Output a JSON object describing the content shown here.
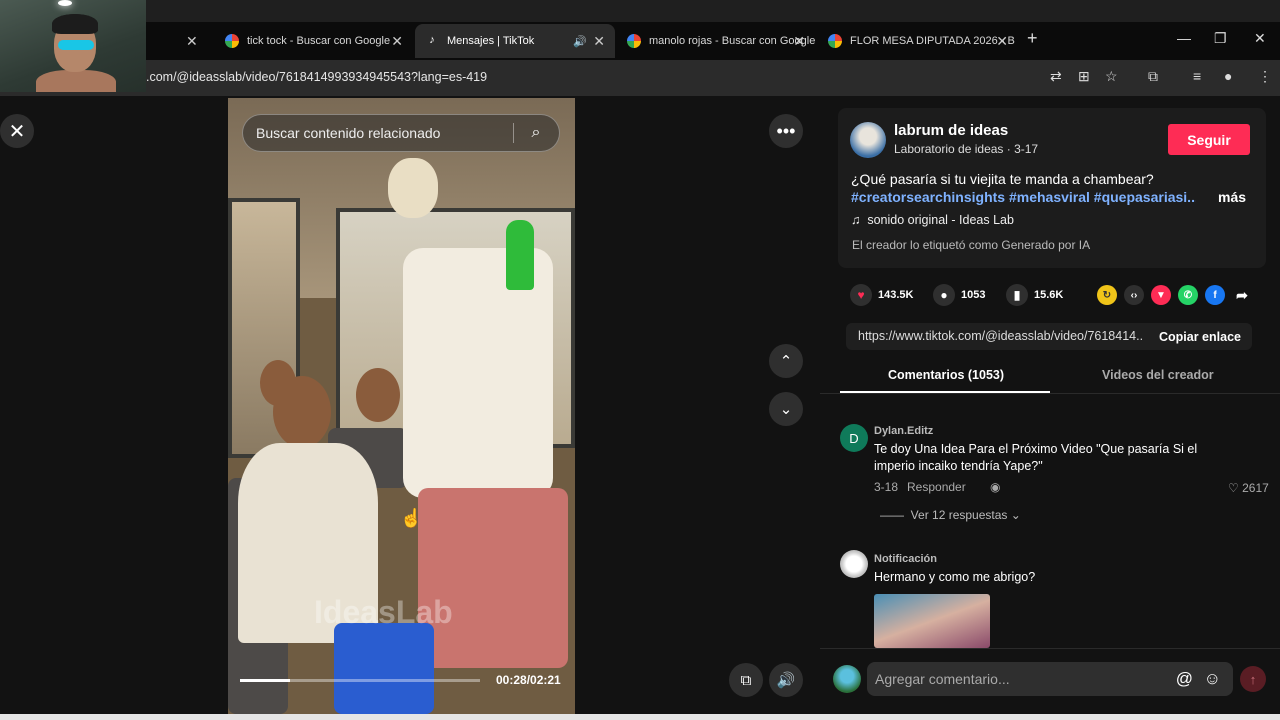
{
  "browser": {
    "tabs": [
      {
        "label": "tick tock - Buscar con Google"
      },
      {
        "label": "Mensajes | TikTok"
      },
      {
        "label": "manolo rojas - Buscar con Google"
      },
      {
        "label": "FLOR MESA DIPUTADA 2026 - B"
      }
    ],
    "close_glyph": "✕",
    "new_tab": "+",
    "window_controls": {
      "minimize": "—",
      "restore": "❐",
      "close": "✕"
    },
    "url": ".com/@ideasslab/video/7618414993934945543?lang=es-419"
  },
  "player": {
    "search_placeholder": "Buscar contenido relacionado",
    "watermark": "IdeasLab",
    "time": "00:28/02:21",
    "progress": 0.21
  },
  "creator": {
    "name": "labrum de ideas",
    "subtitle": "Laboratorio de ideas · 3-17",
    "follow_label": "Seguir",
    "description": "¿Qué pasaría si tu viejita te manda a chambear?",
    "hashtags": "#creatorsearchinsights #mehasviral #quepasariasi...",
    "more_label": "más",
    "sound": "sonido original - Ideas Lab",
    "ai_tag": "El creador lo etiquetó como Generado por IA"
  },
  "stats": {
    "likes": "143.5K",
    "comments": "1053",
    "saves": "15.6K"
  },
  "share": {
    "link": "https://www.tiktok.com/@ideasslab/video/7618414...",
    "copy_label": "Copiar enlace"
  },
  "comment_tabs": [
    "Comentarios (1053)",
    "Videos del creador"
  ],
  "comments": [
    {
      "initial": "D",
      "author": "Dylan.Editz",
      "text_line1": "Te doy Una Idea Para el Próximo Video \"Que pasaría Si el",
      "text_line2": "imperio incaiko tendría Yape?\"",
      "date": "3-18",
      "reply_label": "Responder",
      "likes": "2617",
      "replies_label": "Ver 12 respuestas"
    },
    {
      "author": "Notificación",
      "text": "Hermano y como me abrigo?"
    }
  ],
  "composer": {
    "placeholder": "Agregar comentario..."
  },
  "colors": {
    "accent": "#fe2c55",
    "hashtag": "#7fb2ff",
    "background": "#121212"
  }
}
